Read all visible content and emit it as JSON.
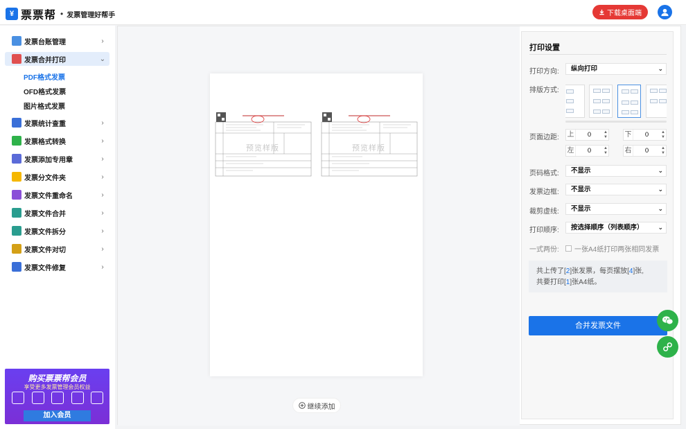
{
  "header": {
    "logo_mark": "¥",
    "logo_text": "票票帮",
    "slogan": "发票管理好帮手",
    "download_label": "下载桌面端"
  },
  "sidebar": {
    "items": [
      {
        "label": "发票台账管理",
        "icon": "ledger-icon",
        "color": "#4a90e2"
      },
      {
        "label": "发票合并打印",
        "icon": "printer-icon",
        "color": "#e05050"
      },
      {
        "label": "发票统计查重",
        "icon": "stats-icon",
        "color": "#3a6fd8"
      },
      {
        "label": "发票格式转换",
        "icon": "convert-icon",
        "color": "#2eb24a"
      },
      {
        "label": "发票添加专用章",
        "icon": "stamp-icon",
        "color": "#5b6bd8"
      },
      {
        "label": "发票分文件夹",
        "icon": "folder-icon",
        "color": "#f5b700"
      },
      {
        "label": "发票文件重命名",
        "icon": "rename-icon",
        "color": "#8a4fd8"
      },
      {
        "label": "发票文件合并",
        "icon": "merge-icon",
        "color": "#2a9d8f"
      },
      {
        "label": "发票文件拆分",
        "icon": "split-icon",
        "color": "#2a9d8f"
      },
      {
        "label": "发票文件对切",
        "icon": "cut-icon",
        "color": "#d4a017"
      },
      {
        "label": "发票文件修复",
        "icon": "repair-icon",
        "color": "#3a6fd8"
      }
    ],
    "sub_items": [
      "PDF格式发票",
      "OFD格式发票",
      "图片格式发票"
    ]
  },
  "promo": {
    "title": "购买票票帮会员",
    "subtitle": "享受更多发票管理会员权益",
    "button": "加入会员"
  },
  "preview": {
    "watermark": "预览样版",
    "add_more_label": "继续添加"
  },
  "settings": {
    "title": "打印设置",
    "orientation_label": "打印方向:",
    "orientation_value": "纵向打印",
    "layout_label": "排版方式:",
    "margin_label": "页面边距:",
    "margins": [
      {
        "side": "上",
        "value": "0"
      },
      {
        "side": "下",
        "value": "0"
      },
      {
        "side": "左",
        "value": "0"
      },
      {
        "side": "右",
        "value": "0"
      }
    ],
    "page_number_label": "页码格式:",
    "page_number_value": "不显示",
    "border_label": "发票边框:",
    "border_value": "不显示",
    "cutline_label": "裁剪虚线:",
    "cutline_value": "不显示",
    "order_label": "打印顺序:",
    "order_value": "按选择顺序（列表顺序）",
    "duplicate_label": "一式两份:",
    "duplicate_text": "一张A4纸打印两张相同发票",
    "summary": {
      "prefix1": "共上传了[",
      "uploaded": "2",
      "mid1": "]张发票，每页摆放[",
      "per_page": "4",
      "suffix1": "]张,",
      "prefix2": "共要打印[",
      "sheets": "1",
      "suffix2": "]张A4纸。"
    },
    "merge_button": "合并发票文件"
  },
  "colors": {
    "primary": "#1a73e8",
    "danger": "#e53935",
    "success": "#2eb24a"
  }
}
